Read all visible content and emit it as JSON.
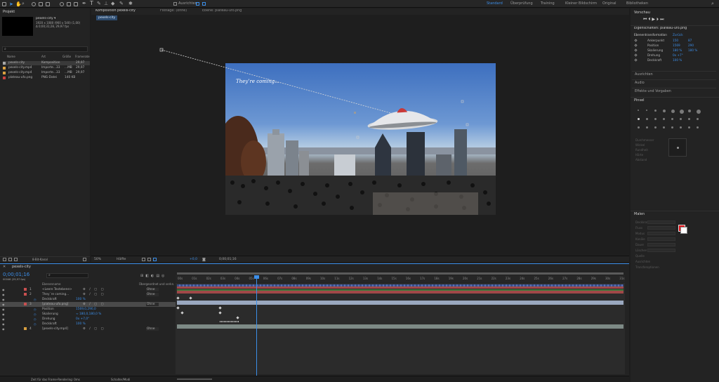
{
  "toolbar": {
    "align_label": "Ausrichten",
    "workspaces": [
      "Standard",
      "Überprüfung",
      "Training",
      "Kleiner Bildschirm",
      "Original",
      "Bibliotheken"
    ],
    "active_workspace": "Standard"
  },
  "project": {
    "title": "Projekt",
    "item_name": "pexels-city ▾",
    "item_info1": "1920 x 1080 (960 x 540) (1,00)",
    "item_info2": "Δ 0;00;31;28, 29,97 fps",
    "columns": {
      "name": "Name",
      "type": "Art",
      "size": "Größe",
      "fps": "Framerate"
    },
    "items": [
      {
        "name": "pexels-city",
        "type": "Komposition",
        "size": "",
        "fps": "29,97",
        "color": "#a8a8a8"
      },
      {
        "name": "pexels-city.mp4",
        "type": "Importe...33",
        "size": "...MB",
        "fps": "29,97",
        "color": "#d9a040"
      },
      {
        "name": "pexels-city.mp4",
        "type": "Importe...33",
        "size": "...MB",
        "fps": "29,97",
        "color": "#d9a040"
      },
      {
        "name": "plateau-ufo.png",
        "type": "PNG-Datei",
        "size": "140 KB",
        "fps": "",
        "color": "#c84040"
      }
    ],
    "footer": "8-Bit-Kanal"
  },
  "viewer": {
    "tabs": [
      "Komposition pexels-city",
      "Footage: (ohne)",
      "Ebene: plateau-ufo.png"
    ],
    "breadcrumb": "pexels-city",
    "overlay_text": "They’re coming...",
    "zoom": "50%",
    "quality": "Hälfte",
    "exposure": "+0,0",
    "time": "0;00;01;16"
  },
  "timeline": {
    "tab": "pexels-city",
    "timecode": "0;00;01;16",
    "timecode_sub": "00046 (29,97 fps)",
    "col_name": "Ebenenname",
    "col_parent": "Übergeordnet und verkn.",
    "layers": [
      {
        "num": "1",
        "name": "<Leere Textebene>",
        "parent": "Ohne",
        "color": "#c85050"
      },
      {
        "num": "2",
        "name": "They´re coming...",
        "parent": "Ohne",
        "color": "#c85050"
      },
      {
        "prop": "Deckkraft",
        "value": "100 %"
      },
      {
        "num": "3",
        "name": "[plateau-ufo.png]",
        "parent": "Ohne",
        "color": "#c85050",
        "selected": true
      },
      {
        "prop": "Position",
        "value": "1569,0,290,0"
      },
      {
        "prop": "Skalierung",
        "value": "∞ 180,0,180,0 %"
      },
      {
        "prop": "Drehung",
        "value": "0x +7,0°"
      },
      {
        "prop": "Deckkraft",
        "value": "100 %"
      },
      {
        "num": "4",
        "name": "[pexels-city.mp4]",
        "parent": "Ohne",
        "color": "#d9a040"
      }
    ],
    "ruler": [
      "00s",
      "01s",
      "02s",
      "03s",
      "04s",
      "05s",
      "06s",
      "07s",
      "08s",
      "09s",
      "10s",
      "11s",
      "12s",
      "13s",
      "14s",
      "15s",
      "16s",
      "17s",
      "18s",
      "19s",
      "20s",
      "21s",
      "22s",
      "23s",
      "24s",
      "25s",
      "26s",
      "27s",
      "28s",
      "29s",
      "30s",
      "31s"
    ],
    "footer_left": "Zeit für das Frame-Rendering: 0ms",
    "footer_mid": "Schalter/Modi"
  },
  "right": {
    "preview_title": "Vorschau",
    "props_title": "Eigenschaften: plateau-ufo.png",
    "transform_label": "Ebenentransformation",
    "reset": "Zurück",
    "props": [
      {
        "label": "Ankerpunkt",
        "v1": "150",
        "v2": "87"
      },
      {
        "label": "Position",
        "v1": "1569",
        "v2": "290"
      },
      {
        "label": "Skalierung",
        "v1": "180 %",
        "v2": "180 %"
      },
      {
        "label": "Drehung",
        "v1": "0x +7°",
        "v2": ""
      },
      {
        "label": "Deckkraft",
        "v1": "100 %",
        "v2": ""
      }
    ],
    "sections": [
      "Ausrichten",
      "Audio",
      "Effekte und Vorgaben"
    ],
    "brush_title": "Pinsel",
    "paint_title": "Malen",
    "brush_labels": [
      "Durchmesser",
      "Winkel",
      "Rundheit",
      "Härte",
      "Abstand"
    ],
    "paint_labels": [
      "Deckkraft",
      "Fluss",
      "Modus",
      "Kanäle",
      "Dauer",
      "Löschen",
      "Quelle",
      "Ausrichten",
      "Transferoptionen"
    ],
    "fg_color": "#e0141a",
    "bg_color": "#ffffff"
  }
}
